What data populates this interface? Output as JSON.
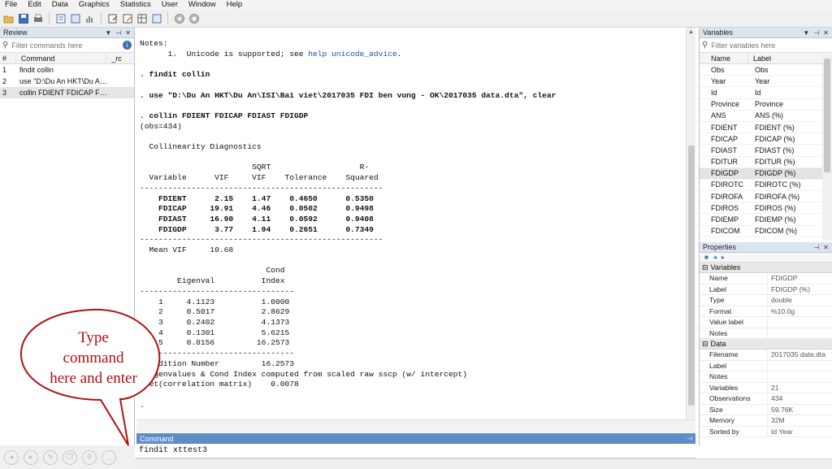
{
  "menu": [
    "File",
    "Edit",
    "Data",
    "Graphics",
    "Statistics",
    "User",
    "Window",
    "Help"
  ],
  "toolbar_icons": [
    "open-icon",
    "save-icon",
    "print-icon",
    "log-icon",
    "viewer-icon",
    "graph-icon",
    "do-file-editor-icon",
    "data-editor-icon",
    "data-browser-icon",
    "variables-manager-icon",
    "break-icon",
    "continue-icon"
  ],
  "review": {
    "title": "Review",
    "filter_placeholder": "Filter commands here",
    "columns": [
      "#",
      "Command",
      "_rc"
    ],
    "rows": [
      {
        "n": "1",
        "cmd": "findit collin"
      },
      {
        "n": "2",
        "cmd": "use \"D:\\Du An HKT\\Du An\\..."
      },
      {
        "n": "3",
        "cmd": "collin FDIENT FDICAP FDIA..."
      }
    ]
  },
  "results": {
    "notes_header": "Notes:",
    "note_1_prefix": "      1.  Unicode is supported; see ",
    "note_1_link": "help unicode_advice",
    "note_1_suffix": ".",
    "cmd_findit": ". findit collin",
    "cmd_use": ". use \"D:\\Du An HKT\\Du An\\ISI\\Bai viet\\2017035 FDI ben vung - OK\\2017035 data.dta\", clear",
    "cmd_collin": ". collin FDIENT FDICAP FDIAST FDIGDP",
    "obs": "(obs=434)",
    "diag_title": "  Collinearity Diagnostics",
    "vif_head_1": "                        SQRT                   R-",
    "vif_head_2": "  Variable      VIF     VIF    Tolerance    Squared",
    "dash_long": "----------------------------------------------------",
    "vif_rows": [
      "    FDIENT      2.15    1.47    0.4650      0.5350",
      "    FDICAP     19.91    4.46    0.0502      0.9498",
      "    FDIAST     16.90    4.11    0.0592      0.9408",
      "    FDIGDP      3.77    1.94    0.2651      0.7349"
    ],
    "mean_vif": "  Mean VIF     10.68",
    "eig_head_1": "                           Cond",
    "eig_head_2": "        Eigenval          Index",
    "dash_short": "---------------------------------",
    "eig_rows": [
      "    1     4.1123          1.0000",
      "    2     0.5017          2.8629",
      "    3     0.2402          4.1373",
      "    4     0.1301          5.6215",
      "    5     0.0156         16.2573"
    ],
    "cond_number": " Condition Number         16.2573",
    "eig_note": " Eigenvalues & Cond Index computed from scaled raw sscp (w/ intercept)",
    "det": " Det(correlation matrix)    0.0078",
    "prompt": "."
  },
  "command": {
    "title": "Command",
    "value": "findit xttest3"
  },
  "variables": {
    "title": "Variables",
    "filter_placeholder": "Filter variables here",
    "columns": [
      "Name",
      "Label"
    ],
    "rows": [
      {
        "name": "Obs",
        "label": "Obs"
      },
      {
        "name": "Year",
        "label": "Year"
      },
      {
        "name": "Id",
        "label": "Id"
      },
      {
        "name": "Province",
        "label": "Province"
      },
      {
        "name": "ANS",
        "label": "ANS (%)"
      },
      {
        "name": "FDIENT",
        "label": "FDIENT (%)"
      },
      {
        "name": "FDICAP",
        "label": "FDICAP (%)"
      },
      {
        "name": "FDIAST",
        "label": "FDIAST (%)"
      },
      {
        "name": "FDITUR",
        "label": "FDITUR (%)"
      },
      {
        "name": "FDIGDP",
        "label": "FDIGDP (%)"
      },
      {
        "name": "FDIROTC",
        "label": "FDIROTC (%)"
      },
      {
        "name": "FDIROFA",
        "label": "FDIROFA (%)"
      },
      {
        "name": "FDIROS",
        "label": "FDIROS (%)"
      },
      {
        "name": "FDIEMP",
        "label": "FDIEMP (%)"
      },
      {
        "name": "FDICOM",
        "label": "FDICOM (%)"
      }
    ],
    "selected": "FDIGDP"
  },
  "properties": {
    "title": "Properties",
    "variables_section": "Variables",
    "variables_rows": [
      {
        "k": "Name",
        "v": "FDIGDP"
      },
      {
        "k": "Label",
        "v": "FDIGDP (%)"
      },
      {
        "k": "Type",
        "v": "double"
      },
      {
        "k": "Format",
        "v": "%10.0g"
      },
      {
        "k": "Value label",
        "v": ""
      },
      {
        "k": "Notes",
        "v": ""
      }
    ],
    "data_section": "Data",
    "data_rows": [
      {
        "k": "Filename",
        "v": "2017035 data.dta"
      },
      {
        "k": "Label",
        "v": ""
      },
      {
        "k": "Notes",
        "v": ""
      },
      {
        "k": "Variables",
        "v": "21"
      },
      {
        "k": "Observations",
        "v": "434"
      },
      {
        "k": "Size",
        "v": "59.76K"
      },
      {
        "k": "Memory",
        "v": "32M"
      },
      {
        "k": "Sorted by",
        "v": "Id Year"
      }
    ]
  },
  "annotation": {
    "line1": "Type",
    "line2": "command",
    "line3": "here and enter",
    "color": "#b30f10"
  }
}
